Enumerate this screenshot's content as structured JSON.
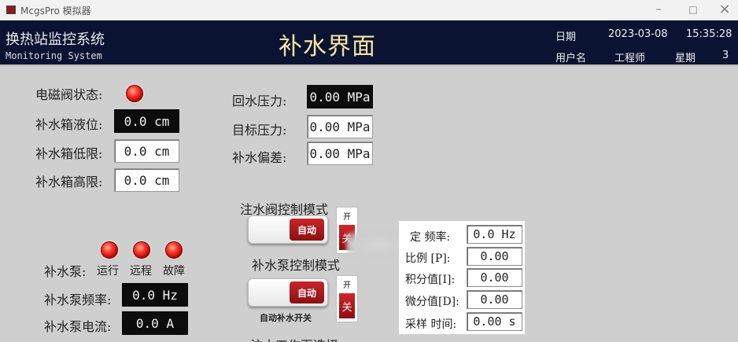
{
  "window": {
    "title": "McgsPro 模拟器",
    "minimize": "–",
    "maximize": "□",
    "close": "×"
  },
  "header": {
    "system_title": "换热站监控系统",
    "system_subtitle": "Monitoring System",
    "page_title": "补水界面",
    "date_label": "日期",
    "date_value": "2023-03-08",
    "time_value": "15:35:28",
    "user_label": "用户名",
    "user_value": "工程师",
    "week_label": "星期",
    "week_value": "3"
  },
  "left": {
    "valve_status_label": "电磁阀状态:",
    "tank_level_label": "补水箱液位:",
    "tank_level_value": "0.0 cm",
    "tank_low_label": "补水箱低限:",
    "tank_low_value": "0.0 cm",
    "tank_high_label": "补水箱高限:",
    "tank_high_value": "0.0 cm"
  },
  "middle": {
    "return_pressure_label": "回水压力:",
    "return_pressure_value": "0.00 MPa",
    "target_pressure_label": "目标压力:",
    "target_pressure_value": "0.00 MPa",
    "deviation_label": "补水偏差:",
    "deviation_value": "0.00 MPa"
  },
  "pump": {
    "label": "补水泵:",
    "status_run": "运行",
    "status_remote": "远程",
    "status_fault": "故障",
    "freq_label": "补水泵频率:",
    "freq_value": "0.0 Hz",
    "current_label": "补水泵电流:",
    "current_value": "0.0 A"
  },
  "controls": {
    "valve_mode_title": "注水阀控制模式",
    "valve_mode_value": "自动",
    "pump_mode_title": "补水泵控制模式",
    "pump_mode_value": "自动",
    "switch_on": "开",
    "switch_off": "关",
    "auto_refill_label": "自动补水开关",
    "cut_off_title": "注水工作页选择"
  },
  "pid": {
    "freq_label": "定 频率:",
    "freq_value": "0.0 Hz",
    "p_label": "比例  [P]:",
    "p_value": "0.00",
    "i_label": "积分值[I]:",
    "i_value": "0.00",
    "d_label": "微分值[D]:",
    "d_value": "0.00",
    "sample_label": "采样 时间:",
    "sample_value": "0.00 s"
  }
}
